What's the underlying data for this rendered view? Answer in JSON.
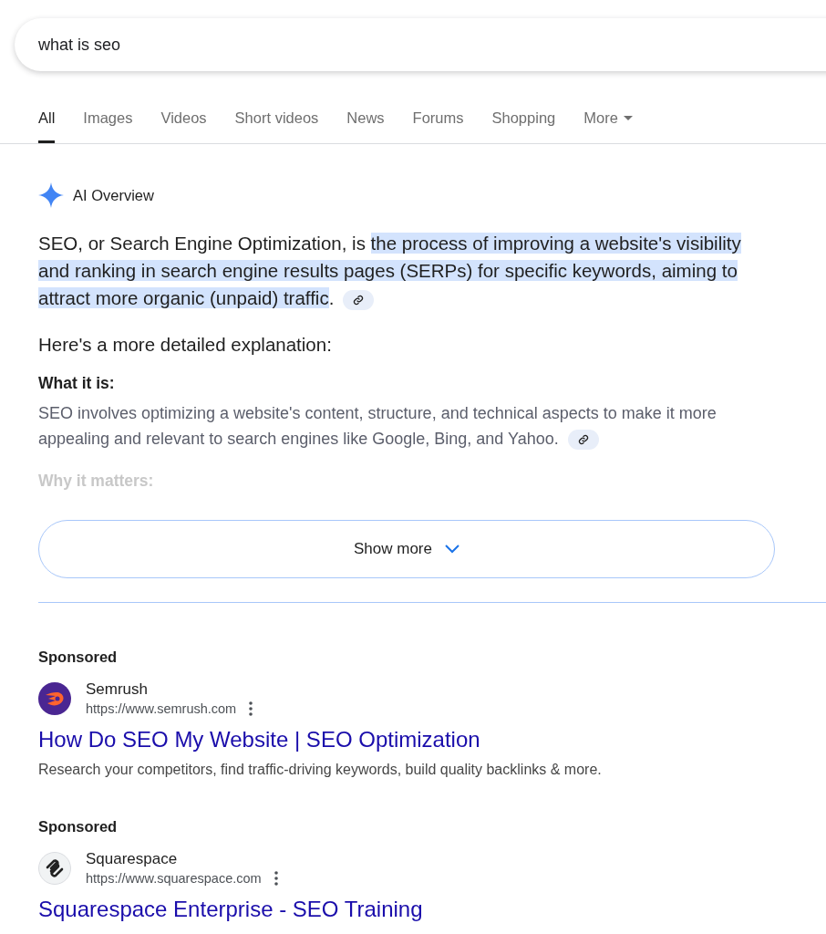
{
  "search": {
    "value": "what is seo"
  },
  "tabs": [
    {
      "label": "All",
      "selected": true,
      "kind": "tab"
    },
    {
      "label": "Images",
      "selected": false,
      "kind": "tab"
    },
    {
      "label": "Videos",
      "selected": false,
      "kind": "tab"
    },
    {
      "label": "Short videos",
      "selected": false,
      "kind": "tab"
    },
    {
      "label": "News",
      "selected": false,
      "kind": "tab"
    },
    {
      "label": "Forums",
      "selected": false,
      "kind": "tab"
    },
    {
      "label": "Shopping",
      "selected": false,
      "kind": "tab"
    },
    {
      "label": "More",
      "selected": false,
      "kind": "menu"
    }
  ],
  "ai_overview": {
    "title": "AI Overview",
    "summary": {
      "lead": "SEO, or Search Engine Optimization, is ",
      "highlight": "the process of improving a website's visibility and ranking in search engine results pages (SERPs) for specific keywords, aiming to attract more organic (unpaid) traffic",
      "tail": "."
    },
    "intro": "Here's a more detailed explanation:",
    "sections": [
      {
        "heading": "What it is:",
        "body": "SEO involves optimizing a website's content, structure, and technical aspects to make it more appealing and relevant to search engines like Google, Bing, and Yahoo.",
        "faded": false
      },
      {
        "heading": "Why it matters:",
        "faded": true
      }
    ],
    "show_more": "Show more"
  },
  "ads": [
    {
      "label": "Sponsored",
      "site": "Semrush",
      "url": "https://www.semrush.com",
      "title": "How Do SEO My Website | SEO Optimization",
      "description": "Research your competitors, find traffic-driving keywords, build quality backlinks & more.",
      "kind": "flame"
    },
    {
      "label": "Sponsored",
      "site": "Squarespace",
      "url": "https://www.squarespace.com",
      "title": "Squarespace Enterprise - SEO Training",
      "kind": "swirl"
    }
  ]
}
